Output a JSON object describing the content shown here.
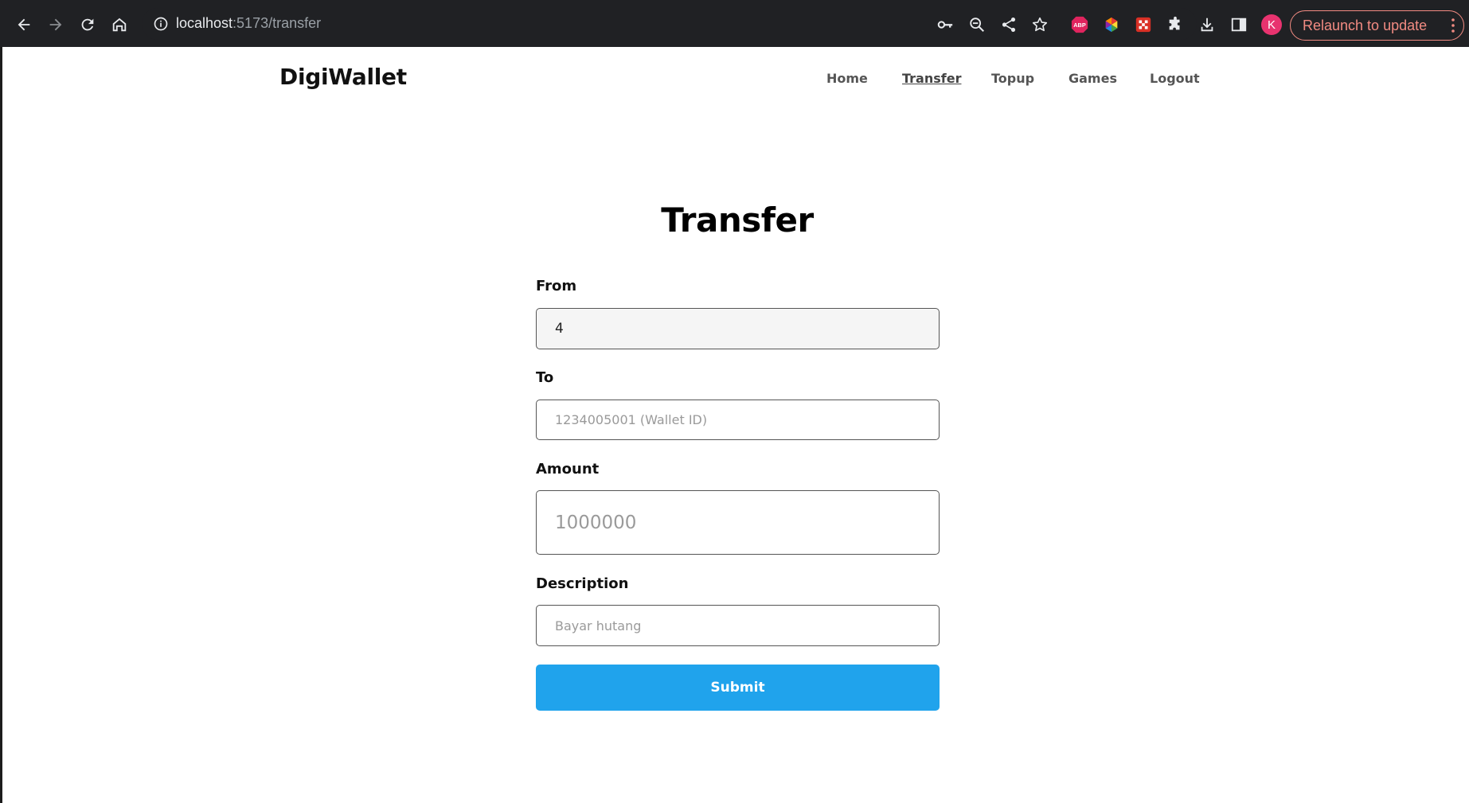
{
  "browser": {
    "url_host": "localhost",
    "url_rest": ":5173/transfer",
    "avatar_initial": "K",
    "relaunch_label": "Relaunch to update",
    "ext_abp_label": "ABP"
  },
  "header": {
    "brand": "DigiWallet",
    "nav": [
      "Home",
      "Transfer",
      "Topup",
      "Games",
      "Logout"
    ],
    "active_nav": "Transfer"
  },
  "form": {
    "title": "Transfer",
    "from_label": "From",
    "from_value": "4",
    "to_label": "To",
    "to_placeholder": "1234005001 (Wallet ID)",
    "amount_label": "Amount",
    "amount_placeholder": "1000000",
    "description_label": "Description",
    "description_placeholder": "Bayar hutang",
    "submit_label": "Submit"
  },
  "colors": {
    "submit": "#20a3ec",
    "chrome_bg": "#202124",
    "relaunch": "#f28b82",
    "avatar": "#e8336f"
  }
}
